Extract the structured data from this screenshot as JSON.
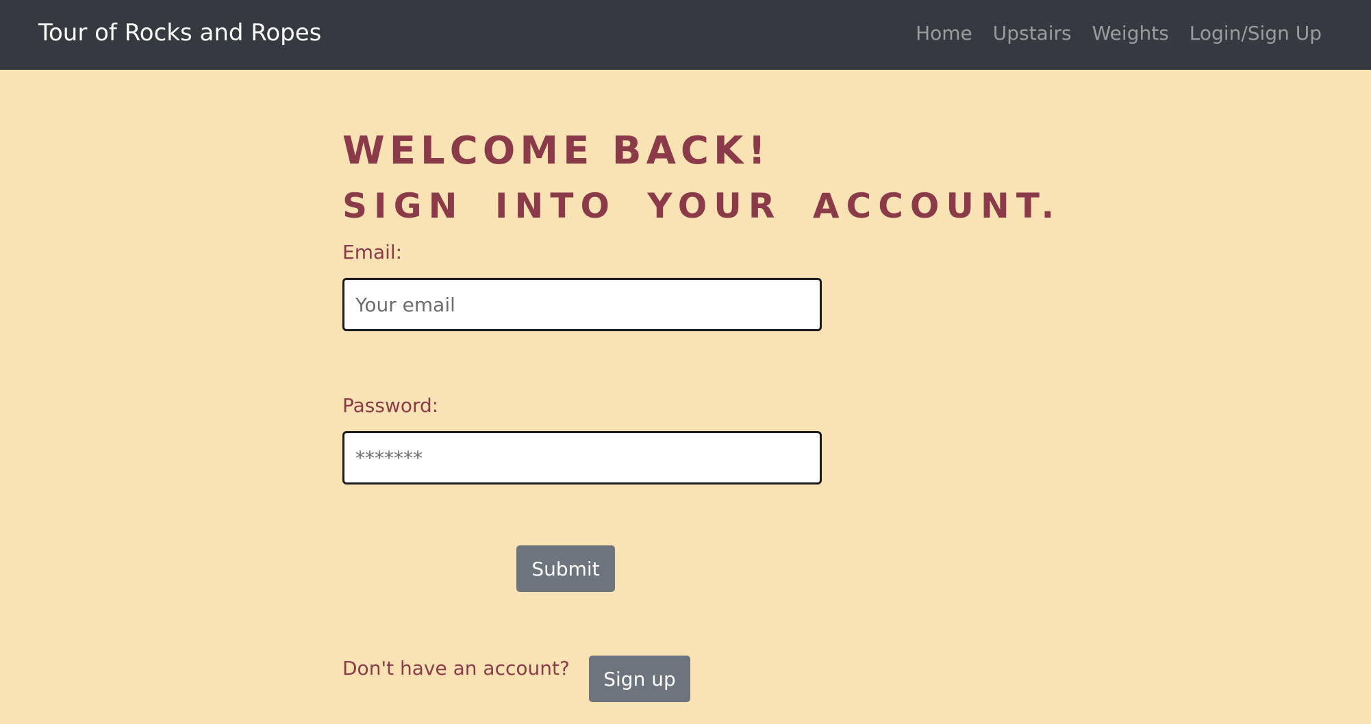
{
  "navbar": {
    "brand": "Tour of Rocks and Ropes",
    "links": [
      "Home",
      "Upstairs",
      "Weights",
      "Login/Sign Up"
    ]
  },
  "form": {
    "heading_line1": "Welcome back!",
    "heading_line2": "Sign into your account.",
    "email_label": "Email:",
    "email_placeholder": "Your email",
    "password_label": "Password:",
    "password_placeholder": "*******",
    "submit_label": "Submit"
  },
  "signup": {
    "prompt": "Don't have an account?",
    "button_label": "Sign up"
  },
  "colors": {
    "page_background": "#f9e3b4",
    "navbar_background": "#343a40",
    "accent_text": "#8b3a4a",
    "button_background": "#6c757d"
  }
}
